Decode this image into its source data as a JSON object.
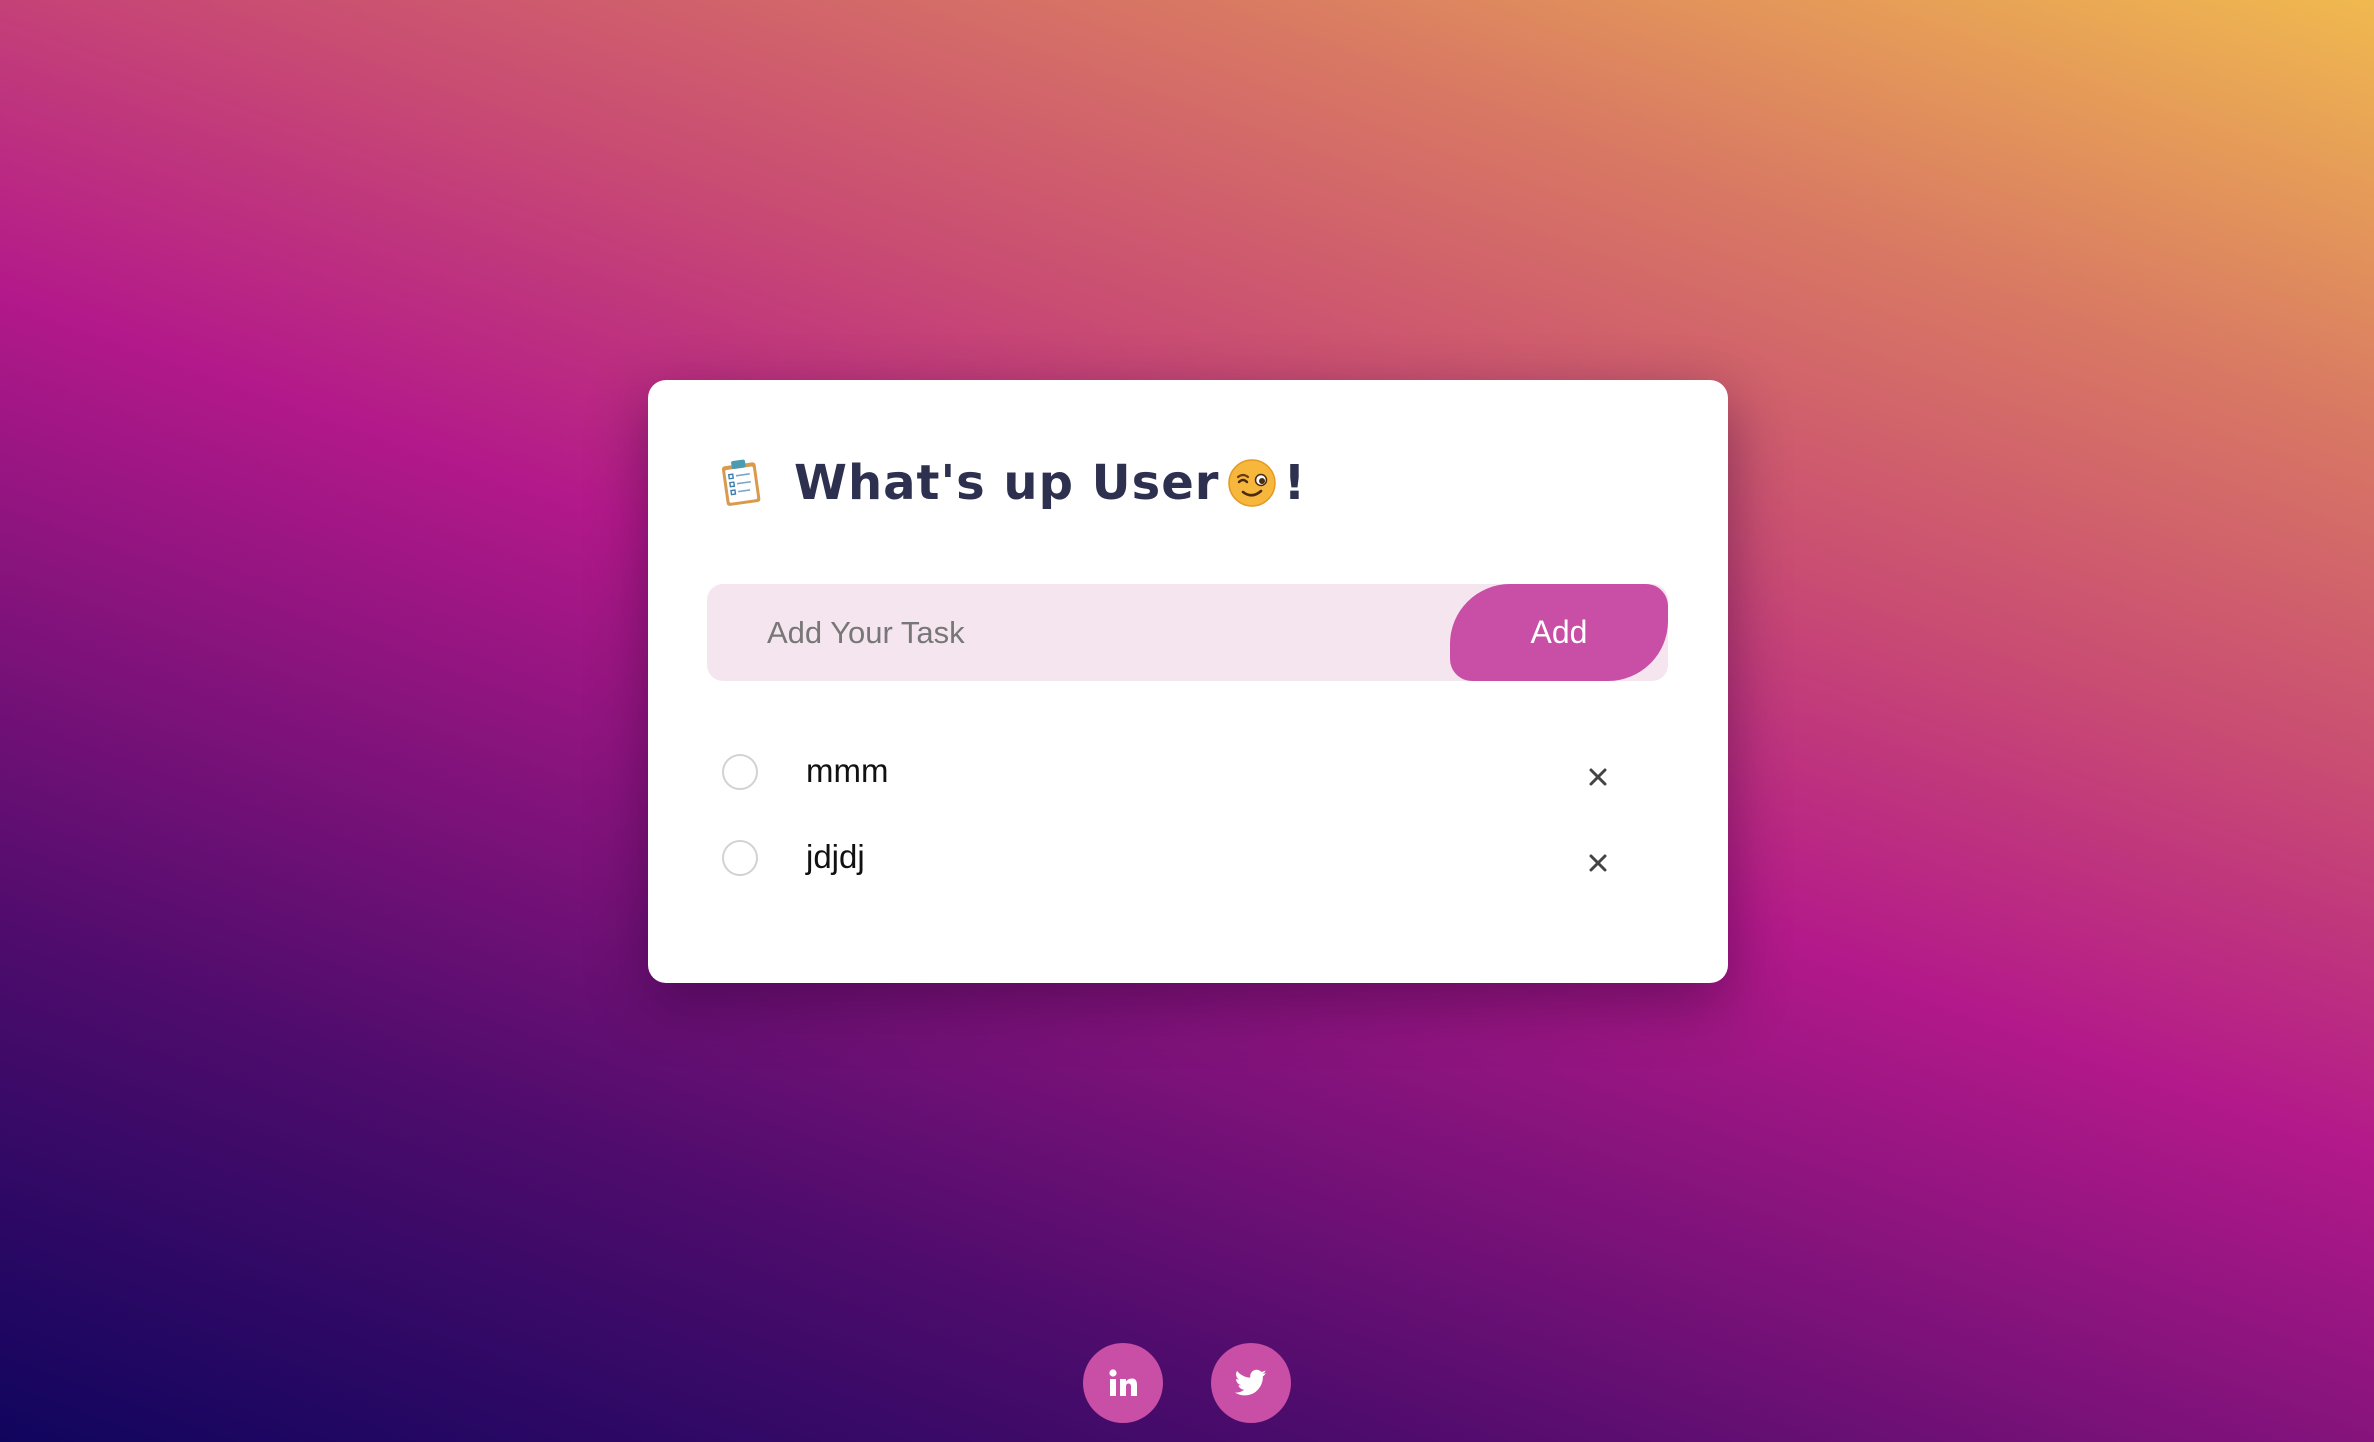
{
  "header": {
    "clipboard_icon": "clipboard-checklist-icon",
    "title": "What's up User",
    "emoji_icon": "winking-face-icon",
    "exclamation": "!"
  },
  "task_form": {
    "placeholder": "Add Your Task",
    "value": "",
    "add_label": "Add"
  },
  "tasks": [
    {
      "label": "mmm",
      "checked": false,
      "remove_icon": "close-icon"
    },
    {
      "label": "jdjdj",
      "checked": false,
      "remove_icon": "close-icon"
    }
  ],
  "social": [
    {
      "name": "LinkedIn",
      "icon": "linkedin-icon"
    },
    {
      "name": "Twitter",
      "icon": "twitter-icon"
    }
  ],
  "colors": {
    "accent": "#c84ea6",
    "input_background": "#f5e5ef",
    "title": "#2e3050",
    "card": "#ffffff"
  }
}
